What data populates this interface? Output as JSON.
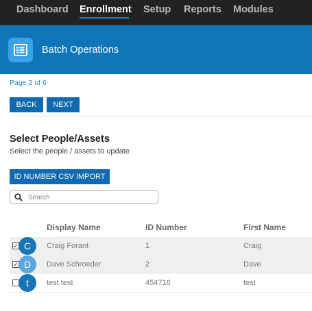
{
  "nav": {
    "items": [
      "Dashboard",
      "Enrollment",
      "Setup",
      "Reports",
      "Modules"
    ],
    "active": "Enrollment",
    "accent": "#1d88c8"
  },
  "banner": {
    "icon": "list-icon",
    "title": "Batch Operations",
    "color": "#0f75b9"
  },
  "pagination": {
    "indicator": "Page 2 of 6",
    "back_label": "BACK",
    "next_label": "NEXT"
  },
  "section": {
    "title": "Select People/Assets",
    "subtitle": "Select the people / assets to update",
    "csv_button": "ID NUMBER CSV IMPORT"
  },
  "search": {
    "placeholder": "Search",
    "value": "",
    "icon": "search-icon"
  },
  "table": {
    "columns": [
      "Display Name",
      "ID Number",
      "First Name"
    ],
    "rows": [
      {
        "checked": true,
        "initial": "C",
        "avatar_color": "#1776b8",
        "display_name": "Craig Forant",
        "id_number": "1",
        "first_name": "Craig"
      },
      {
        "checked": true,
        "initial": "D",
        "avatar_color": "#5aa6df",
        "display_name": "Dave Schroeder",
        "id_number": "2",
        "first_name": "Dave"
      },
      {
        "checked": false,
        "initial": "t",
        "avatar_color": "#1776b8",
        "display_name": "test test",
        "id_number": "454716",
        "first_name": "test"
      }
    ]
  }
}
